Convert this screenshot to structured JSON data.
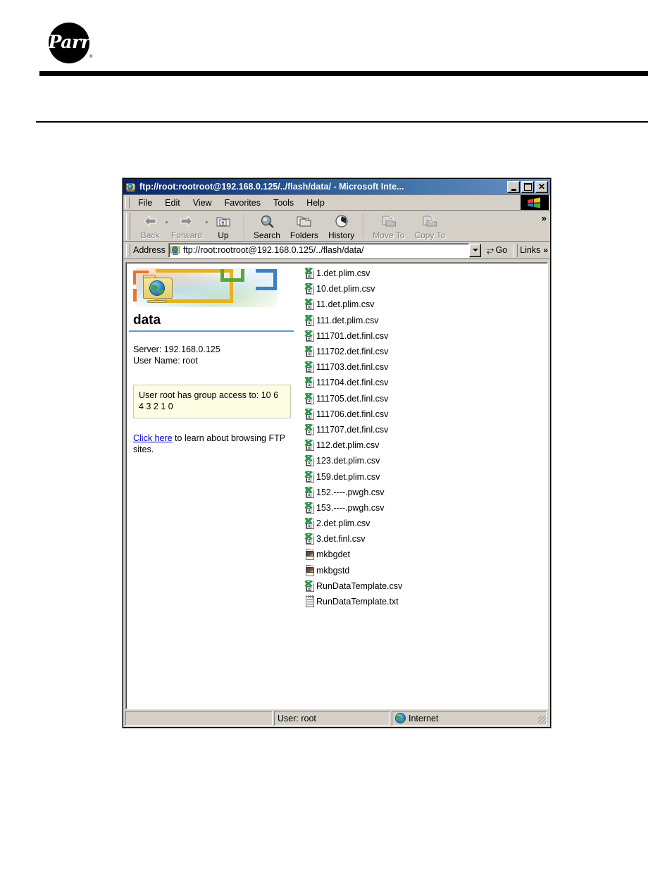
{
  "letterhead": {
    "logo_text": "Parr",
    "logo_registered": "®",
    "logo_name": "parr-logo"
  },
  "window": {
    "title": "ftp://root:rootroot@192.168.0.125/../flash/data/ - Microsoft Inte...",
    "title_icon": "ftp-folder-icon",
    "controls": {
      "minimize": "_",
      "maximize": "❐",
      "close": "✕"
    }
  },
  "menubar": {
    "items": [
      {
        "label": "File"
      },
      {
        "label": "Edit"
      },
      {
        "label": "View"
      },
      {
        "label": "Favorites"
      },
      {
        "label": "Tools"
      },
      {
        "label": "Help"
      }
    ],
    "brand_icon": "windows-flag-icon"
  },
  "toolbar": {
    "buttons": [
      {
        "label": "Back",
        "icon": "back-arrow-icon",
        "disabled": true,
        "has_dropdown": true
      },
      {
        "label": "Forward",
        "icon": "forward-arrow-icon",
        "disabled": true,
        "has_dropdown": true
      },
      {
        "label": "Up",
        "icon": "up-folder-icon",
        "disabled": false,
        "has_dropdown": false
      },
      {
        "label": "Search",
        "icon": "search-icon",
        "disabled": false,
        "has_dropdown": false
      },
      {
        "label": "Folders",
        "icon": "folders-icon",
        "disabled": false,
        "has_dropdown": false
      },
      {
        "label": "History",
        "icon": "history-clock-icon",
        "disabled": false,
        "has_dropdown": false
      },
      {
        "label": "Move To",
        "icon": "move-to-icon",
        "disabled": true,
        "has_dropdown": false
      },
      {
        "label": "Copy To",
        "icon": "copy-to-icon",
        "disabled": true,
        "has_dropdown": false
      }
    ],
    "overflow_chevron": "»"
  },
  "addressbar": {
    "label": "Address",
    "favicon": "ftp-folder-icon",
    "url": "ftp://root:rootroot@192.168.0.125/../flash/data/",
    "dropdown_icon": "chevron-down-icon",
    "go_label": "Go",
    "go_icon": "go-arrow-icon",
    "links_label": "Links",
    "links_chevron": "»"
  },
  "left_pane": {
    "banner_icon": "ftp-folder-globe-icon",
    "folder_title": "data",
    "server_line": "Server: 192.168.0.125",
    "user_line": "User Name: root",
    "group_access": "User root has group access to: 10 6 4 3 2 1 0",
    "help_link": "Click here",
    "help_rest": " to learn about browsing FTP sites."
  },
  "files": [
    {
      "name": "1.det.plim.csv",
      "icon": "csv-file-icon"
    },
    {
      "name": "10.det.plim.csv",
      "icon": "csv-file-icon"
    },
    {
      "name": "11.det.plim.csv",
      "icon": "csv-file-icon"
    },
    {
      "name": "111.det.plim.csv",
      "icon": "csv-file-icon"
    },
    {
      "name": "111701.det.finl.csv",
      "icon": "csv-file-icon"
    },
    {
      "name": "111702.det.finl.csv",
      "icon": "csv-file-icon"
    },
    {
      "name": "111703.det.finl.csv",
      "icon": "csv-file-icon"
    },
    {
      "name": "111704.det.finl.csv",
      "icon": "csv-file-icon"
    },
    {
      "name": "111705.det.finl.csv",
      "icon": "csv-file-icon"
    },
    {
      "name": "111706.det.finl.csv",
      "icon": "csv-file-icon"
    },
    {
      "name": "111707.det.finl.csv",
      "icon": "csv-file-icon"
    },
    {
      "name": "112.det.plim.csv",
      "icon": "csv-file-icon"
    },
    {
      "name": "123.det.plim.csv",
      "icon": "csv-file-icon"
    },
    {
      "name": "159.det.plim.csv",
      "icon": "csv-file-icon"
    },
    {
      "name": "152.----.pwgh.csv",
      "icon": "csv-file-icon"
    },
    {
      "name": "153.----.pwgh.csv",
      "icon": "csv-file-icon"
    },
    {
      "name": "2.det.plim.csv",
      "icon": "csv-file-icon"
    },
    {
      "name": "3.det.finl.csv",
      "icon": "csv-file-icon"
    },
    {
      "name": "mkbgdet",
      "icon": "binary-file-icon"
    },
    {
      "name": "mkbgstd",
      "icon": "binary-file-icon"
    },
    {
      "name": "RunDataTemplate.csv",
      "icon": "csv-file-icon"
    },
    {
      "name": "RunDataTemplate.txt",
      "icon": "text-file-icon"
    }
  ],
  "statusbar": {
    "left": "",
    "user": "User: root",
    "zone": "Internet",
    "zone_icon": "internet-globe-icon"
  }
}
